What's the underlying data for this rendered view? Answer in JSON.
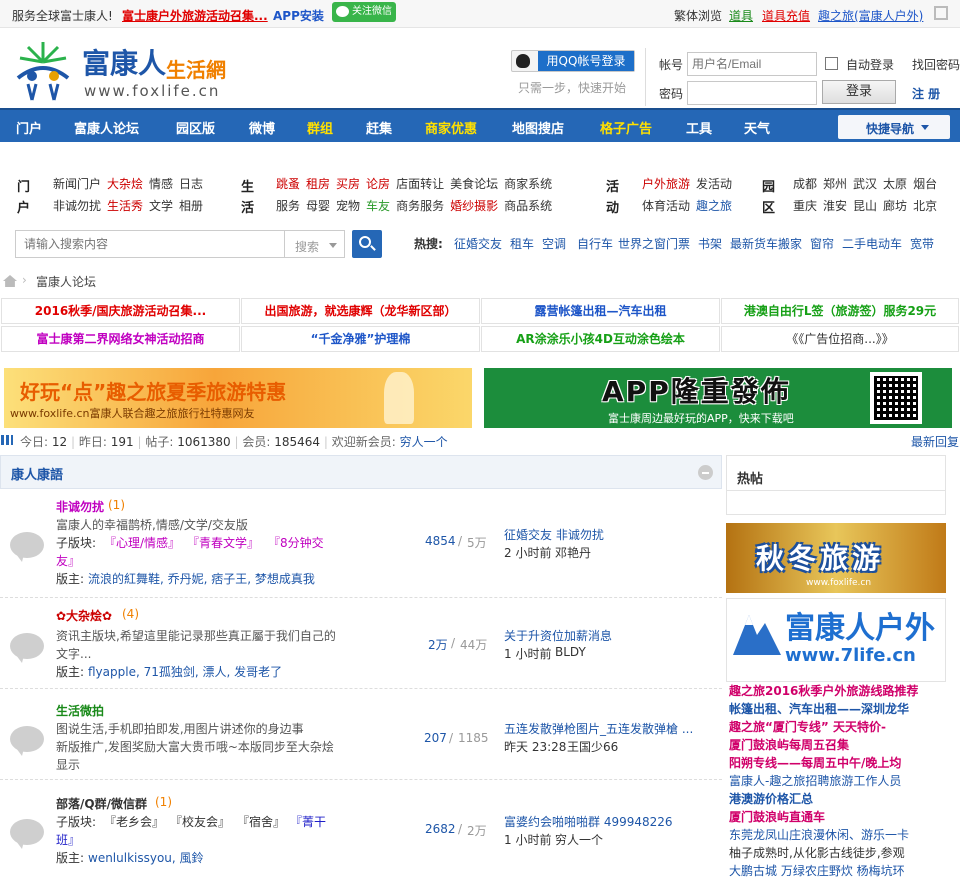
{
  "topbar": {
    "welcome": "服务全球富士康人!",
    "promo": "富士康户外旅游活动召集...",
    "app": "APP安装",
    "wechat": "关注微信",
    "trad": "繁体浏览",
    "tools": "道具",
    "recharge": "道具充值",
    "brand_link": "趣之旅(富康人户外)"
  },
  "logo": {
    "title": "富康人",
    "sub": "生活網",
    "url": "www.foxlife.cn"
  },
  "login": {
    "qq_btn": "用QQ帐号登录",
    "qq_hint": "只需一步，快速开始",
    "account_label": "帐号",
    "account_placeholder": "用户名/Email",
    "password_label": "密码",
    "auto_login": "自动登录",
    "login_btn": "登录",
    "find_pwd": "找回密码",
    "register": "注 册"
  },
  "nav": [
    "门户",
    "富康人论坛",
    "园区版",
    "微博",
    "群组",
    "赶集",
    "商家优惠",
    "地图搜店",
    "格子广告",
    "工具",
    "天气"
  ],
  "nav_quick": "快捷导航",
  "categories": {
    "menhu": {
      "h1": "门",
      "h2": "户",
      "row1": [
        "新闻门户",
        "大杂烩",
        "情感",
        "日志"
      ],
      "row2": [
        "非诚勿扰",
        "生活秀",
        "文学",
        "相册"
      ]
    },
    "shenghuo": {
      "h1": "生",
      "h2": "活",
      "row1": [
        "跳蚤",
        "租房",
        "买房",
        "论房",
        "店面转让",
        "美食论坛",
        "商家系统"
      ],
      "row2": [
        "服务",
        "母婴",
        "宠物",
        "车友",
        "商务服务",
        "婚纱摄影",
        "商品系统"
      ]
    },
    "huodong": {
      "h1": "活",
      "h2": "动",
      "row1": [
        "户外旅游",
        "发活动"
      ],
      "row2": [
        "体育活动",
        "趣之旅"
      ]
    },
    "yuanqu": {
      "h1": "园",
      "h2": "区",
      "row1": [
        "成都",
        "郑州",
        "武汉",
        "太原",
        "烟台"
      ],
      "row2": [
        "重庆",
        "淮安",
        "昆山",
        "廊坊",
        "北京"
      ]
    }
  },
  "search": {
    "placeholder": "请输入搜索内容",
    "type": "搜索",
    "hot_label": "热搜:",
    "hot": [
      "征婚交友",
      "租车",
      "空调",
      "自行车",
      "世界之窗门票",
      "书架",
      "最新货车搬家",
      "窗帘",
      "二手电动车",
      "宽带"
    ]
  },
  "breadcrumb": "富康人论坛",
  "ads": [
    {
      "text": "2016秋季/国庆旅游活动召集...",
      "color": "#e00000"
    },
    {
      "text": "出国旅游，就选康辉（龙华新区部）",
      "color": "#e00000"
    },
    {
      "text": "露营帐篷出租—汽车出租",
      "color": "#1e56c8"
    },
    {
      "text": "港澳自由行L签（旅游签）服务29元",
      "color": "#16a016"
    },
    {
      "text": "富士康第二界网络女神活动招商",
      "color": "#c000c0"
    },
    {
      "text": "“千金净雅”护理棉",
      "color": "#1e56c8"
    },
    {
      "text": "AR涂涂乐小孩4D互动涂色绘本",
      "color": "#16a016"
    },
    {
      "text": "《《广告位招商...》》",
      "color": "#333333"
    }
  ],
  "banners": {
    "left_title": "好玩“点”趣之旅夏季旅游特惠",
    "left_sub": "www.foxlife.cn富康人联合趣之旅旅行社特惠网友",
    "right_title": "APP隆重發佈",
    "right_sub": "富士康周边最好玩的APP，快来下载吧"
  },
  "stats": {
    "today_label": "今日:",
    "today": "12",
    "yesterday_label": "昨日:",
    "yesterday": "191",
    "posts_label": "帖子:",
    "posts": "1061380",
    "members_label": "会员:",
    "members": "185464",
    "welcome": "欢迎新会员:",
    "newest": "穷人一个",
    "latest_reply": "最新回复"
  },
  "section_title": "康人康語",
  "forums": [
    {
      "name": "非诚勿扰",
      "count": "(1)",
      "desc": "富康人的幸福鹊桥,情感/文学/交友版",
      "sub_label": "子版块:",
      "subs": [
        "『心理/情感』",
        "『青春文学』",
        "『8分钟交"
      ],
      "subs2": "友』",
      "mod_label": "版主:",
      "mods": "流浪的紅舞鞋, 乔丹妮, 痞子王, 梦想成真我",
      "threads": "4854",
      "posts": "5万",
      "last_title": "征婚交友 非诚勿扰",
      "last_time": "2 小时前",
      "last_user": "邓艳丹"
    },
    {
      "name": "✿大杂烩✿",
      "count": "(4)",
      "desc": "资讯主版块,希望這里能记录那些真正屬于我们自己的",
      "desc2": "文字...",
      "mod_label": "版主:",
      "mods": "flyapple, 71孤独剑, 漂人, 发哥老了",
      "threads": "2万",
      "posts": "44万",
      "last_title": "关于升资位加薪消息",
      "last_time": "1 小时前",
      "last_user": "BLDY"
    },
    {
      "name": "生活微拍",
      "count": "",
      "desc": "图说生活,手机即拍即发,用图片讲述你的身边事",
      "desc2": "新版推广,发图奖励大富大贵币哦~本版同步至大杂烩",
      "desc3": "显示",
      "threads": "207",
      "posts": "1185",
      "last_title": "五连发散弹枪图片_五连发散弹槍 ...",
      "last_time": "昨天 23:28",
      "last_user": "王国少66"
    },
    {
      "name": "部落/Q群/微信群",
      "count": "(1)",
      "sub_label": "子版块:",
      "subs": [
        "『老乡会』",
        "『校友会』",
        "『宿舍』",
        "『菁干"
      ],
      "subs2": "班』",
      "mod_label": "版主:",
      "mods": "wenlulkissyou, 風鈴",
      "threads": "2682",
      "posts": "2万",
      "last_title": "富婆约会啪啪啪群 499948226",
      "last_time": "1 小时前",
      "last_user": "穷人一个"
    }
  ],
  "side": {
    "hot_title": "热帖",
    "img1": "秋冬旅游",
    "img1_url": "www.foxlife.cn",
    "img2": "富康人户外",
    "img2_url": "www.7life.cn",
    "links": [
      {
        "t": "趣之旅2016秋季户外旅游线路推荐",
        "c": "#d0006a"
      },
      {
        "t": "帐篷出租、汽车出租——深圳龙华",
        "c": "#1e56a8"
      },
      {
        "t": "趣之旅“厦门专线” 天天特价-",
        "c": "#d0006a"
      },
      {
        "t": "厦门鼓浪屿每周五召集",
        "c": "#d0006a"
      },
      {
        "t": "阳朔专线——每周五中午/晚上均",
        "c": "#d0006a"
      },
      {
        "t": "富康人-趣之旅招聘旅游工作人员",
        "c": "#1e56a8"
      },
      {
        "t": "港澳游价格汇总",
        "c": "#1e56a8"
      },
      {
        "t": "厦门鼓浪屿直通车",
        "c": "#d0006a"
      },
      {
        "t": "东莞龙凤山庄浪漫休闲、游乐一卡",
        "c": "#1e56a8"
      },
      {
        "t": "柚子成熟时,从化影古线徒步,参观",
        "c": "#333333"
      },
      {
        "t": "大鹏古城 万绿农庄野炊 杨梅坑环",
        "c": "#1e56a8"
      }
    ]
  }
}
